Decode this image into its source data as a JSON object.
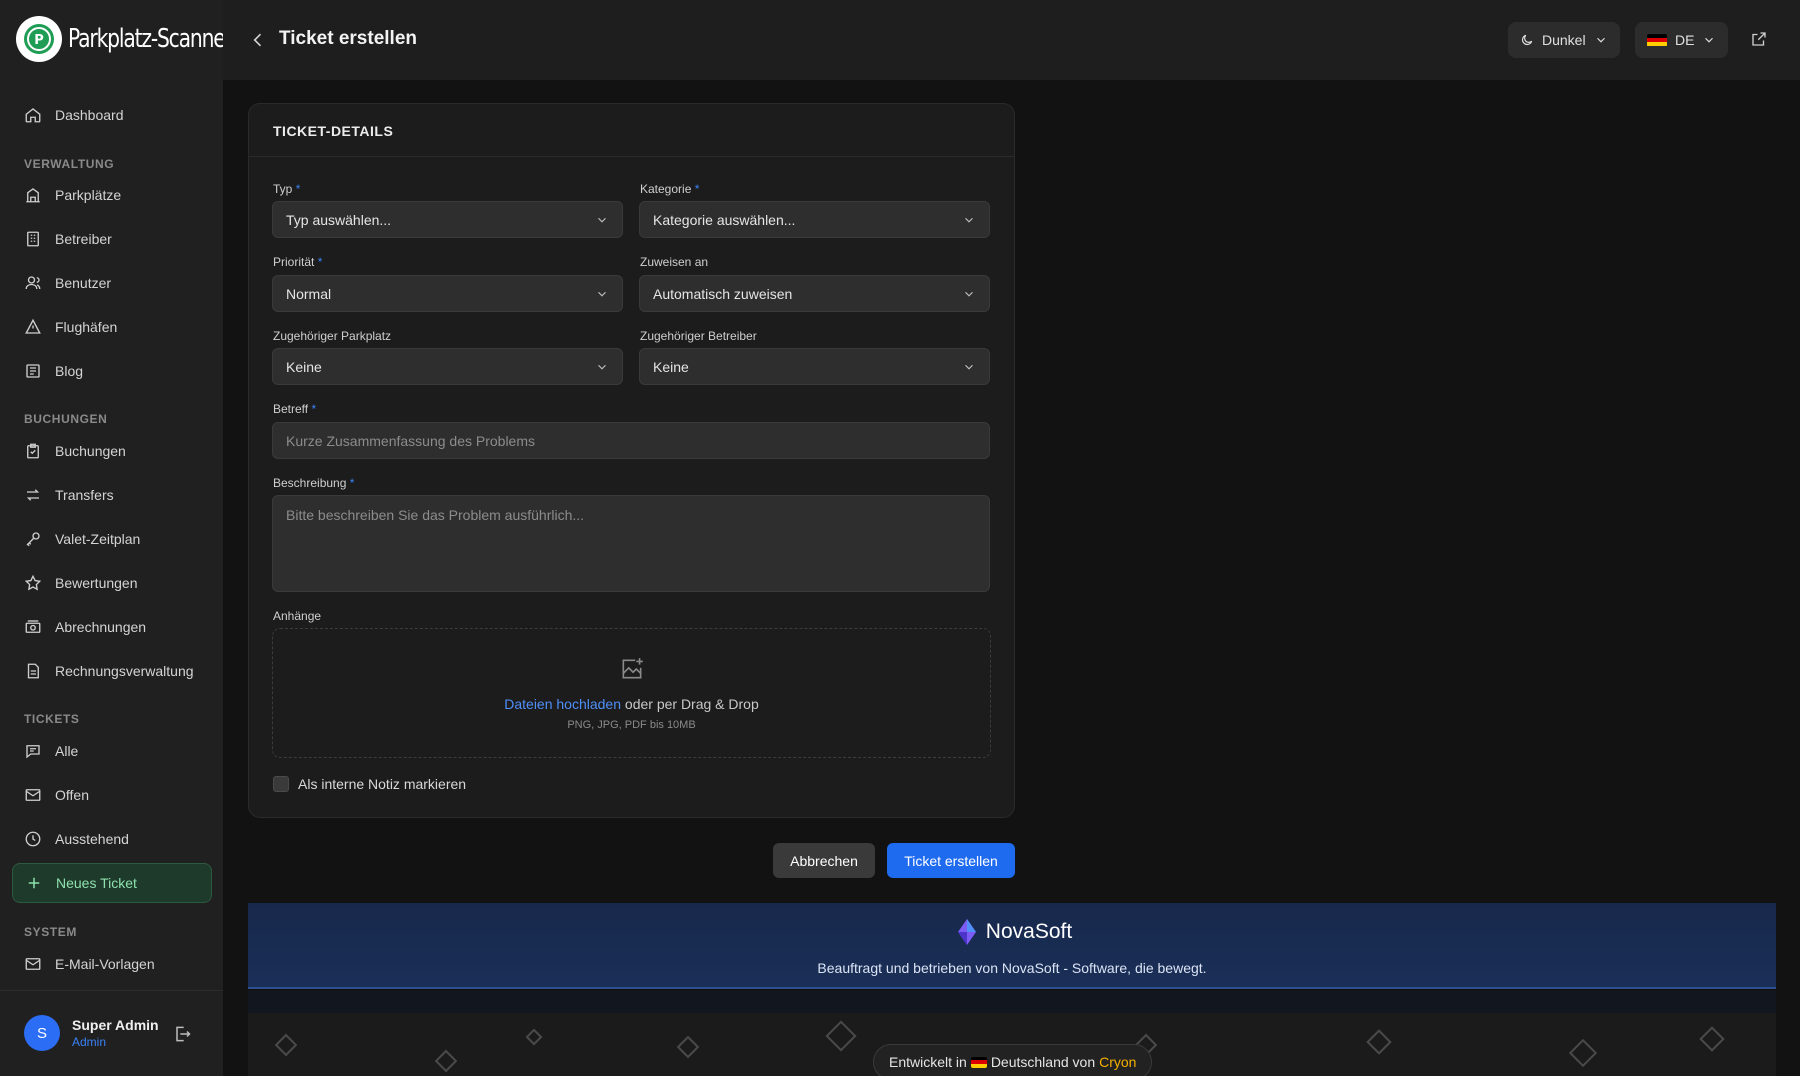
{
  "brand": {
    "name": "Parkplatz-Scanner"
  },
  "header": {
    "title": "Ticket erstellen",
    "theme_label": "Dunkel",
    "lang_label": "DE"
  },
  "nav": {
    "dashboard": "Dashboard",
    "sections": {
      "verwaltung": "VERWALTUNG",
      "buchungen": "BUCHUNGEN",
      "tickets": "TICKETS",
      "system": "SYSTEM"
    },
    "items": {
      "parkplaetze": "Parkplätze",
      "betreiber": "Betreiber",
      "benutzer": "Benutzer",
      "flughaefen": "Flughäfen",
      "blog": "Blog",
      "buchungen": "Buchungen",
      "transfers": "Transfers",
      "valet": "Valet-Zeitplan",
      "bewertungen": "Bewertungen",
      "abrechnungen": "Abrechnungen",
      "rechnungen": "Rechnungsverwaltung",
      "alle": "Alle",
      "offen": "Offen",
      "ausstehend": "Ausstehend",
      "neues_ticket": "Neues Ticket",
      "email_vorlagen": "E-Mail-Vorlagen"
    }
  },
  "user": {
    "initial": "S",
    "name": "Super Admin",
    "role": "Admin"
  },
  "form": {
    "section_title": "TICKET-DETAILS",
    "required_mark": "*",
    "typ": {
      "label": "Typ",
      "value": "Typ auswählen..."
    },
    "kategorie": {
      "label": "Kategorie",
      "value": "Kategorie auswählen..."
    },
    "prioritaet": {
      "label": "Priorität",
      "value": "Normal"
    },
    "zuweisen": {
      "label": "Zuweisen an",
      "value": "Automatisch zuweisen"
    },
    "parkplatz": {
      "label": "Zugehöriger Parkplatz",
      "value": "Keine"
    },
    "betreiber": {
      "label": "Zugehöriger Betreiber",
      "value": "Keine"
    },
    "betreff": {
      "label": "Betreff",
      "placeholder": "Kurze Zusammenfassung des Problems"
    },
    "beschreibung": {
      "label": "Beschreibung",
      "placeholder": "Bitte beschreiben Sie das Problem ausführlich..."
    },
    "anhaenge": {
      "label": "Anhänge",
      "upload_link": "Dateien hochladen",
      "upload_rest": "oder per Drag & Drop",
      "hint": "PNG, JPG, PDF bis 10MB"
    },
    "internal_note_label": "Als interne Notiz markieren"
  },
  "actions": {
    "cancel": "Abbrechen",
    "submit": "Ticket erstellen"
  },
  "banner": {
    "brand": "NovaSoft",
    "tagline": "Beauftragt und betrieben von NovaSoft - Software, die bewegt."
  },
  "footer": {
    "prefix": "Entwickelt in",
    "country": "Deutschland von",
    "company": "Cryon"
  },
  "colors": {
    "accent": "#1f6bf0",
    "active_nav": "#8ee0ad",
    "brand_orange": "#f5b000"
  },
  "icons": {
    "dashboard": "home-icon",
    "parkplaetze": "building-icon",
    "betreiber": "office-icon",
    "benutzer": "users-icon",
    "flughaefen": "triangle-icon",
    "blog": "newspaper-icon",
    "buchungen": "clipboard-icon",
    "transfers": "arrows-icon",
    "valet": "key-icon",
    "bewertungen": "star-icon",
    "abrechnungen": "cash-icon",
    "rechnungen": "document-icon",
    "alle": "chat-icon",
    "offen": "mail-icon",
    "ausstehend": "clock-icon",
    "neues_ticket": "plus-icon",
    "email_vorlagen": "mail-icon"
  }
}
